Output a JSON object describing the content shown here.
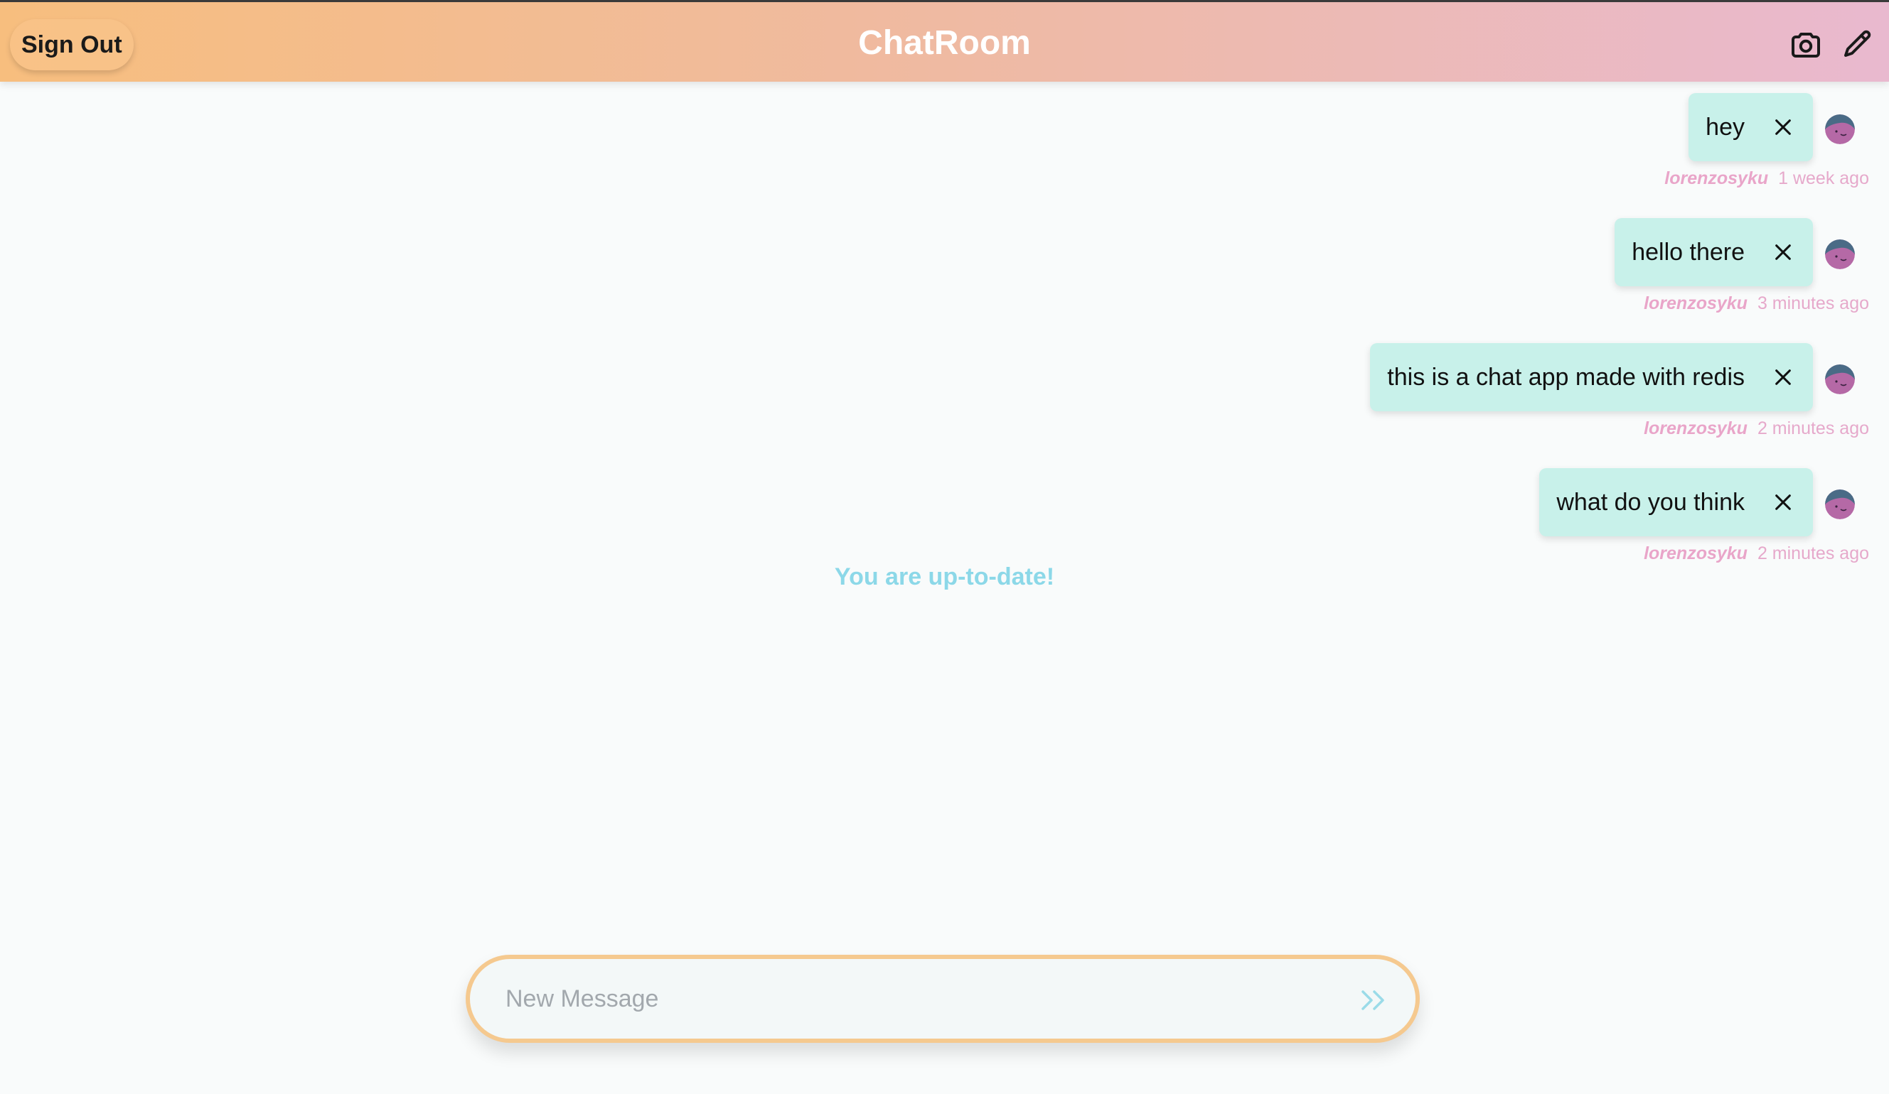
{
  "header": {
    "signout_label": "Sign Out",
    "title": "ChatRoom",
    "icons": [
      "camera-icon",
      "pencil-icon"
    ]
  },
  "messages": [
    {
      "text": "hey",
      "user": "lorenzosyku",
      "time": "1 week ago"
    },
    {
      "text": "hello there",
      "user": "lorenzosyku",
      "time": "3 minutes ago"
    },
    {
      "text": "this is a chat app made with redis",
      "user": "lorenzosyku",
      "time": "2 minutes ago"
    },
    {
      "text": "what do you think",
      "user": "lorenzosyku",
      "time": "2 minutes ago"
    }
  ],
  "status": {
    "uptodate": "You are up-to-date!"
  },
  "composer": {
    "placeholder": "New Message",
    "value": ""
  },
  "colors": {
    "header_start": "#f7be7e",
    "header_end": "#e9b9cf",
    "bubble": "#c8f1ea",
    "meta_pink": "#e9a5c9",
    "status_blue": "#8cd8e8",
    "composer_border": "#f5c98f"
  }
}
